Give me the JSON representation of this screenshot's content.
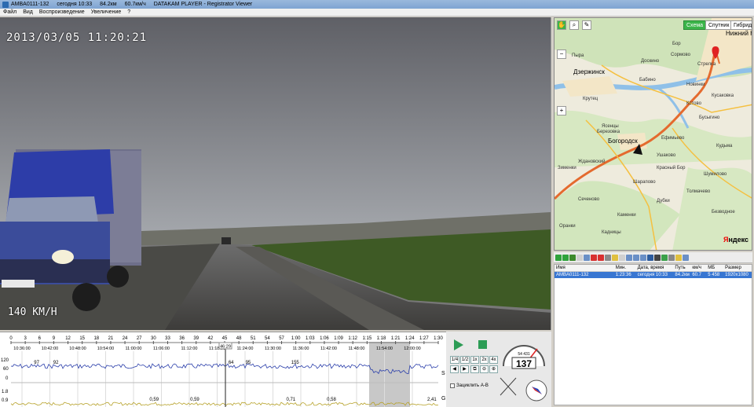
{
  "titlebar": {
    "file": "AMBA0111-132",
    "date": "сегодня 10:33",
    "distance": "84.2км",
    "speed": "60.7км/ч",
    "app": "DATAKAM PLAYER - Registrator Viewer"
  },
  "menu": [
    "Файл",
    "Вид",
    "Воспроизведение",
    "Увеличение",
    "?"
  ],
  "video": {
    "timestamp": "2013/03/05 11:20:21",
    "speed_overlay": "140 KM/H"
  },
  "map": {
    "modes": [
      "Схема",
      "Спутник",
      "Гибрид"
    ],
    "active_mode": "Схема",
    "labels": {
      "city_big_1": "Дзержинск",
      "city_big_2": "Богородск",
      "city_big_3": "Нижний Н",
      "l1": "Пыра",
      "l2": "Бабино",
      "l3": "Ясенцы",
      "l4": "Березовка",
      "l5": "Ефимьево",
      "l6": "Кстово",
      "l7": "Бусыгино",
      "l8": "Сормово",
      "l9": "Доскино",
      "l10": "Кудьма",
      "l11": "Новинки",
      "l12": "Кусаковка",
      "l13": "Ушаково",
      "l14": "Каменки",
      "l15": "Шумилово",
      "l16": "Ждановский",
      "l17": "Безводное",
      "l18": "Красный Бор",
      "l19": "Сеченово",
      "l20": "Зименки",
      "l21": "Толмачево",
      "l22": "Шарапово",
      "l23": "Дубки",
      "l24": "Стрелка",
      "l25": "Кадницы",
      "l26": "Крутец",
      "l27": "Оранки",
      "l28": "Бор"
    },
    "logo_y": "Я",
    "logo_rest": "ндекс"
  },
  "filelist": {
    "columns": [
      "Имя",
      "Мин.",
      "Дата, время",
      "Путь",
      "км/ч",
      "МБ",
      "Размер"
    ],
    "rows": [
      [
        "AMBA0111-132",
        "1:23:36",
        "сегодня 10:33",
        "84.2км",
        "60.7",
        "5 458",
        "1920x1080"
      ]
    ]
  },
  "timeline": {
    "minute_ticks": [
      "0",
      "3",
      "6",
      "9",
      "12",
      "15",
      "18",
      "21",
      "24",
      "27",
      "30",
      "33",
      "36",
      "39",
      "42",
      "45",
      "48",
      "51",
      "54",
      "57",
      "1:00",
      "1:03",
      "1:06",
      "1:09",
      "1:12",
      "1:15",
      "1:18",
      "1:21",
      "1:24",
      "1:27",
      "1:30"
    ],
    "clock_ticks": [
      "10:36:00",
      "10:42:00",
      "10:48:00",
      "10:54:00",
      "11:00:00",
      "11:06:00",
      "11:12:00",
      "11:18:00",
      "11:24:00",
      "11:30:00",
      "11:36:00",
      "11:42:00",
      "11:48:00",
      "11:54:00",
      "12:00:00"
    ],
    "cursor_label": "46:29",
    "speed_axis": [
      "120",
      "60",
      "0"
    ],
    "g_axis": [
      "1.8",
      "0.9"
    ],
    "speed_peaks": [
      {
        "t": 0.06,
        "v": "97"
      },
      {
        "t": 0.105,
        "v": "92"
      },
      {
        "t": 0.515,
        "v": "64"
      },
      {
        "t": 0.555,
        "v": "95"
      },
      {
        "t": 0.665,
        "v": "155"
      }
    ],
    "g_peaks": [
      {
        "t": 0.335,
        "v": "0,59"
      },
      {
        "t": 0.43,
        "v": "0,59"
      },
      {
        "t": 0.655,
        "v": "0,71"
      },
      {
        "t": 0.75,
        "v": "0,58"
      },
      {
        "t": 0.985,
        "v": "2,41"
      }
    ],
    "side_s": "S",
    "side_g": "G"
  },
  "controls": {
    "speed_buttons": [
      "1/4",
      "1/2",
      "1x",
      "2x",
      "4x"
    ],
    "loop_label": "Зациклить A-B",
    "speedo_value": "137",
    "odometer": "54 431"
  }
}
